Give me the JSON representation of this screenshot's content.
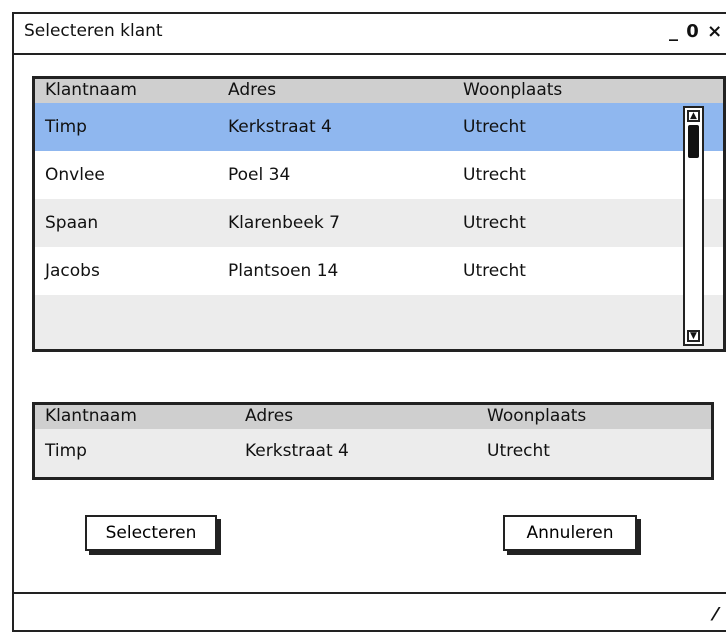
{
  "window": {
    "title": "Selecteren klant",
    "controls": {
      "minimize": "_",
      "maximize": "0",
      "close": "×"
    }
  },
  "customers_table": {
    "columns": [
      "Klantnaam",
      "Adres",
      "Woonplaats"
    ],
    "rows": [
      {
        "klantnaam": "Timp",
        "adres": "Kerkstraat 4",
        "woonplaats": "Utrecht",
        "selected": true
      },
      {
        "klantnaam": "Onvlee",
        "adres": "Poel 34",
        "woonplaats": "Utrecht",
        "selected": false
      },
      {
        "klantnaam": "Spaan",
        "adres": "Klarenbeek 7",
        "woonplaats": "Utrecht",
        "selected": false
      },
      {
        "klantnaam": "Jacobs",
        "adres": "Plantsoen 14",
        "woonplaats": "Utrecht",
        "selected": false
      }
    ]
  },
  "selection_table": {
    "columns": [
      "Klantnaam",
      "Adres",
      "Woonplaats"
    ],
    "rows": [
      {
        "klantnaam": "Timp",
        "adres": "Kerkstraat 4",
        "woonplaats": "Utrecht"
      }
    ]
  },
  "buttons": {
    "select_label": "Selecteren",
    "cancel_label": "Annuleren"
  },
  "colors": {
    "selected_row": "#8fb7ef",
    "header": "#cfcfcf",
    "alt_row": "#ececec"
  }
}
